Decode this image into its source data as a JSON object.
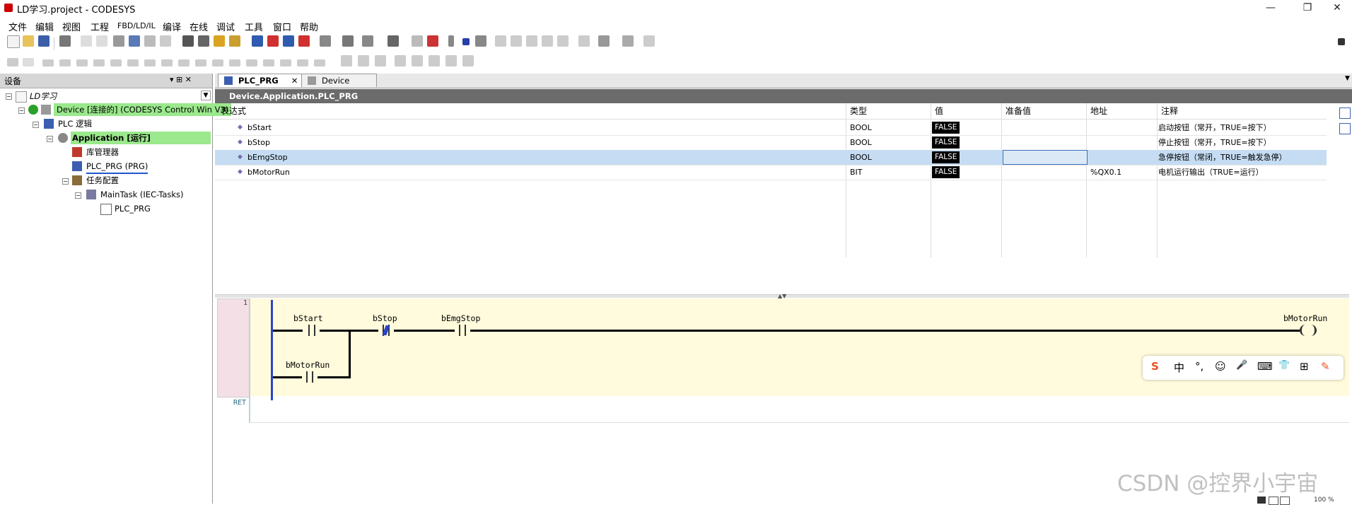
{
  "window": {
    "title": "LD学习.project - CODESYS",
    "min": "—",
    "max": "❐",
    "close": "✕"
  },
  "menu": [
    "文件",
    "编辑",
    "视图",
    "工程",
    "FBD/LD/IL",
    "编译",
    "在线",
    "调试",
    "工具",
    "窗口",
    "帮助"
  ],
  "devices_panel": {
    "title": "设备",
    "pin": "▾ ⊞ ✕",
    "tree": [
      {
        "label": "LD学习",
        "indent": 0
      },
      {
        "label": "Device [连接的] (CODESYS Control Win V3)",
        "indent": 1
      },
      {
        "label": "PLC 逻辑",
        "indent": 2
      },
      {
        "label": "Application [运行]",
        "indent": 3
      },
      {
        "label": "库管理器",
        "indent": 4
      },
      {
        "label": "PLC_PRG (PRG)",
        "indent": 4
      },
      {
        "label": "任务配置",
        "indent": 4
      },
      {
        "label": "MainTask (IEC-Tasks)",
        "indent": 5
      },
      {
        "label": "PLC_PRG",
        "indent": 6
      }
    ]
  },
  "tabs": [
    "PLC_PRG",
    "Device"
  ],
  "path": "Device.Application.PLC_PRG",
  "watch": {
    "columns": [
      "表达式",
      "类型",
      "值",
      "准备值",
      "地址",
      "注释"
    ],
    "rows": [
      {
        "expr": "bStart",
        "type": "BOOL",
        "value": "FALSE",
        "prepared": "",
        "address": "",
        "comment": "启动按钮（常开，TRUE=按下）"
      },
      {
        "expr": "bStop",
        "type": "BOOL",
        "value": "FALSE",
        "prepared": "",
        "address": "",
        "comment": "停止按钮（常开，TRUE=按下）"
      },
      {
        "expr": "bEmgStop",
        "type": "BOOL",
        "value": "FALSE",
        "prepared": "",
        "address": "",
        "comment": "急停按钮（常闭，TRUE=触发急停）"
      },
      {
        "expr": "bMotorRun",
        "type": "BIT",
        "value": "FALSE",
        "prepared": "",
        "address": "%QX0.1",
        "comment": "电机运行输出（TRUE=运行）"
      }
    ]
  },
  "ladder": {
    "network_no": "1",
    "contacts": [
      "bStart",
      "bStop",
      "bEmgStop",
      "bMotorRun"
    ],
    "coil": "bMotorRun",
    "ret": "RET"
  },
  "ime_toolbar": [
    "S",
    "中",
    "°,",
    "☺",
    "🎤",
    "⌨",
    "👕",
    "⊞",
    "✎"
  ],
  "watermark": "CSDN @控界小宇宙",
  "zoom": "100 %"
}
